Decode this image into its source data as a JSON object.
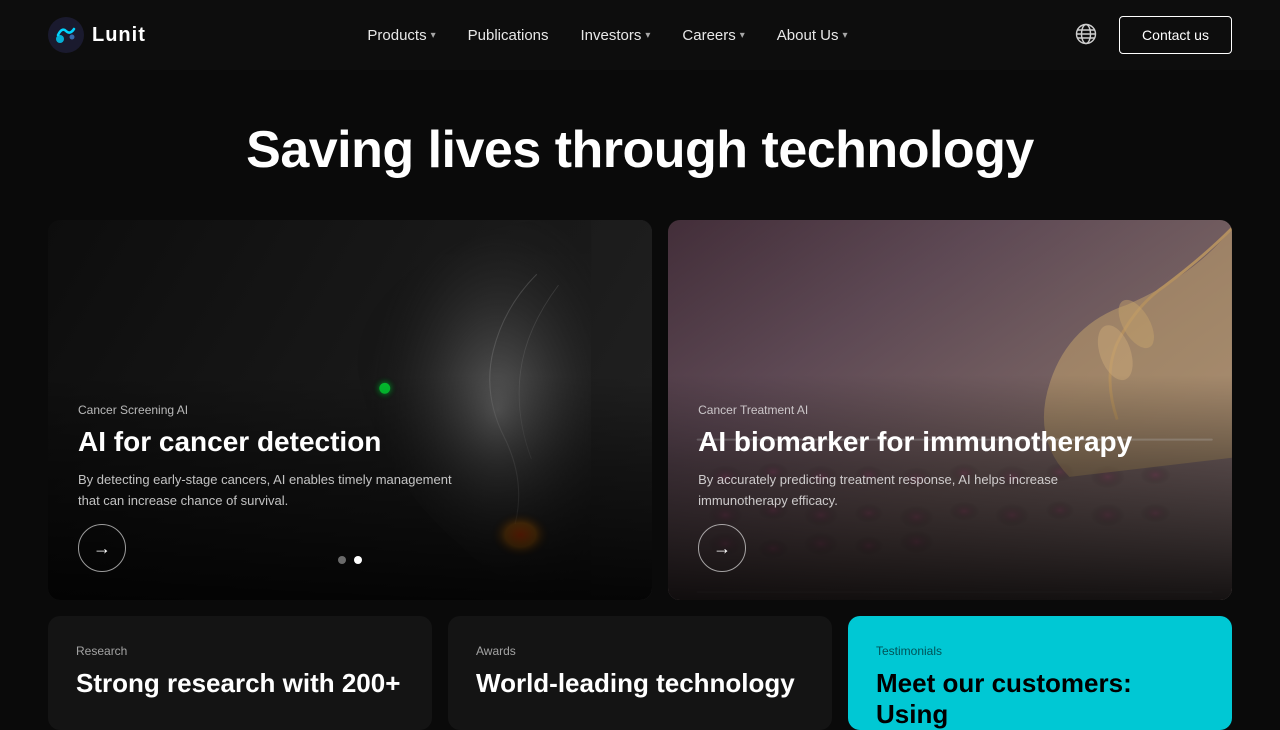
{
  "nav": {
    "logo_text": "Lunit",
    "links": [
      {
        "label": "Products",
        "has_dropdown": true
      },
      {
        "label": "Publications",
        "has_dropdown": false
      },
      {
        "label": "Investors",
        "has_dropdown": true
      },
      {
        "label": "Careers",
        "has_dropdown": true
      },
      {
        "label": "About Us",
        "has_dropdown": true
      }
    ],
    "contact_label": "Contact us"
  },
  "hero": {
    "headline": "Saving lives through technology"
  },
  "card_left": {
    "tag": "Cancer Screening AI",
    "title": "AI for cancer detection",
    "description": "By detecting early-stage cancers, AI enables timely management that can increase chance of survival.",
    "arrow_label": "→"
  },
  "card_right": {
    "tag": "Cancer Treatment AI",
    "title": "AI biomarker for immunotherapy",
    "description": "By accurately predicting treatment response, AI helps increase immunotherapy efficacy.",
    "arrow_label": "→"
  },
  "slide_dots": {
    "dot1_active": false,
    "dot2_active": true
  },
  "bottom_cards": [
    {
      "tag": "Research",
      "title": "Strong research with 200+",
      "color": "dark"
    },
    {
      "tag": "Awards",
      "title": "World-leading technology",
      "color": "dark"
    },
    {
      "tag": "Testimonials",
      "title": "Meet our customers: Using",
      "color": "cyan"
    }
  ]
}
